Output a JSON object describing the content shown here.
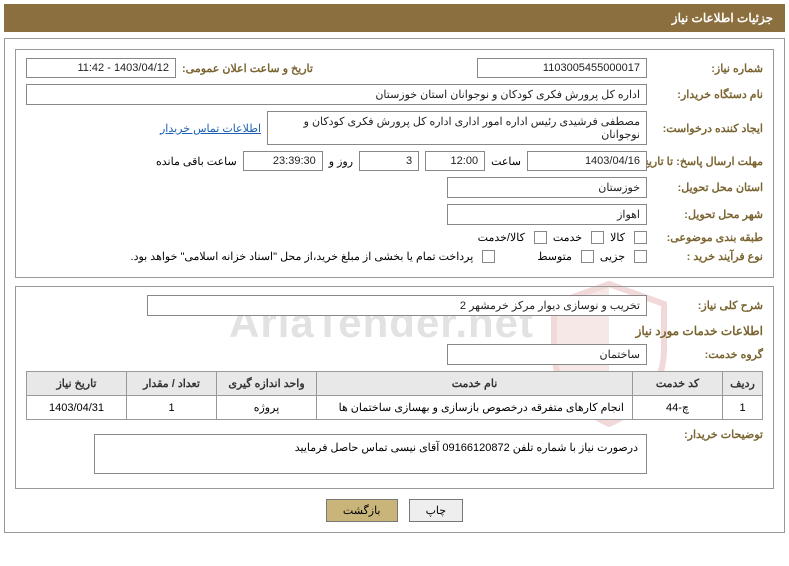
{
  "header": {
    "title": "جزئیات اطلاعات نیاز"
  },
  "section1": {
    "need_no_label": "شماره نیاز:",
    "need_no": "1103005455000017",
    "announce_label": "تاریخ و ساعت اعلان عمومی:",
    "announce_val": "1403/04/12 - 11:42",
    "buyer_label": "نام دستگاه خریدار:",
    "buyer_val": "اداره کل پرورش فکری کودکان و نوجوانان استان خوزستان",
    "requester_label": "ایجاد کننده درخواست:",
    "requester_val": "مصطفی فرشیدی رئیس اداره امور اداری  اداره کل پرورش فکری کودکان و نوجوانان",
    "contact_link": "اطلاعات تماس خریدار",
    "deadline_label": "مهلت ارسال پاسخ: تا تاریخ:",
    "deadline_date": "1403/04/16",
    "time_label": "ساعت",
    "deadline_time": "12:00",
    "days_val": "3",
    "days_label": "روز و",
    "remaining_time": "23:39:30",
    "remaining_label": "ساعت باقی مانده",
    "province_label": "استان محل تحویل:",
    "province_val": "خوزستان",
    "city_label": "شهر محل تحویل:",
    "city_val": "اهواز",
    "category_label": "طبقه بندی موضوعی:",
    "cat_goods": "کالا",
    "cat_service": "خدمت",
    "cat_goods_service": "کالا/خدمت",
    "proc_label": "نوع فرآیند خرید :",
    "proc_partial": "جزیی",
    "proc_medium": "متوسط",
    "payment_note": "پرداخت تمام یا بخشی از مبلغ خرید،از محل \"اسناد خزانه اسلامی\" خواهد بود."
  },
  "section2": {
    "overview_label": "شرح کلی نیاز:",
    "overview_val": "تخریب و نوسازی دیوار مرکز خرمشهر 2",
    "services_title": "اطلاعات خدمات مورد نیاز",
    "group_label": "گروه خدمت:",
    "group_val": "ساختمان",
    "table": {
      "headers": {
        "row": "ردیف",
        "code": "کد خدمت",
        "name": "نام خدمت",
        "unit": "واحد اندازه گیری",
        "qty": "تعداد / مقدار",
        "date": "تاریخ نیاز"
      },
      "rows": [
        {
          "row": "1",
          "code": "چ-44",
          "name": "انجام کارهای متفرقه درخصوص بازسازی و بهسازی ساختمان ها",
          "unit": "پروژه",
          "qty": "1",
          "date": "1403/04/31"
        }
      ]
    },
    "buyer_note_label": "توضیحات خریدار:",
    "buyer_note": "درصورت نیاز با شماره تلفن 09166120872 آقای نیسی تماس حاصل فرمایید"
  },
  "buttons": {
    "print": "چاپ",
    "back": "بازگشت"
  },
  "watermark": "AriaTender.net"
}
